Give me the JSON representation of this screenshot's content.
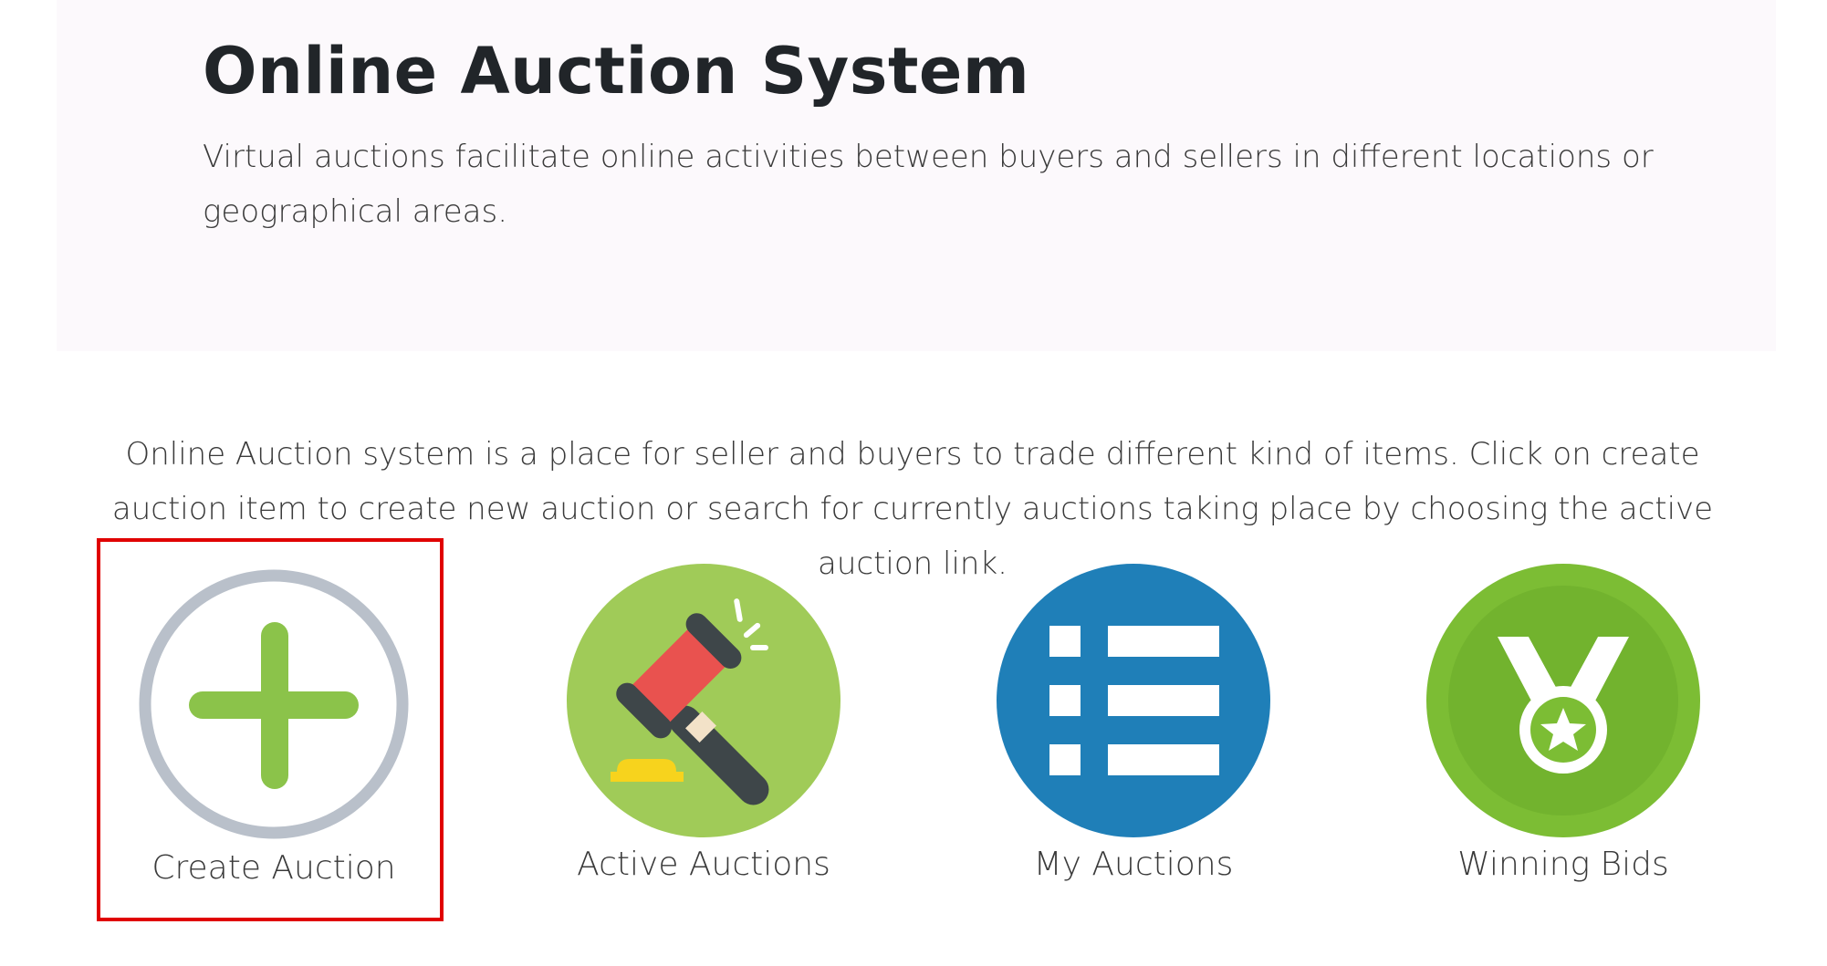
{
  "header": {
    "title": "Online Auction System",
    "lead": "Virtual auctions facilitate online activities between buyers and sellers in different locations or geographical areas."
  },
  "intro": {
    "text": "Online Auction system is a place for seller and buyers to trade different kind of items. Click on create auction item to create new auction or search for currently auctions taking place by choosing the active auction link."
  },
  "tiles": [
    {
      "label": "Create Auction",
      "icon": "plus-circle-icon",
      "highlighted": true
    },
    {
      "label": "Active Auctions",
      "icon": "gavel-icon",
      "highlighted": false
    },
    {
      "label": "My Auctions",
      "icon": "list-icon",
      "highlighted": false
    },
    {
      "label": "Winning Bids",
      "icon": "medal-icon",
      "highlighted": false
    }
  ],
  "colors": {
    "jumbotron_bg": "#fcf9fc",
    "highlight_border": "#e00000",
    "green": "#8bc34a",
    "blue": "#1f7fb8",
    "gray_ring": "#b9c0ca",
    "red": "#e9524f"
  }
}
